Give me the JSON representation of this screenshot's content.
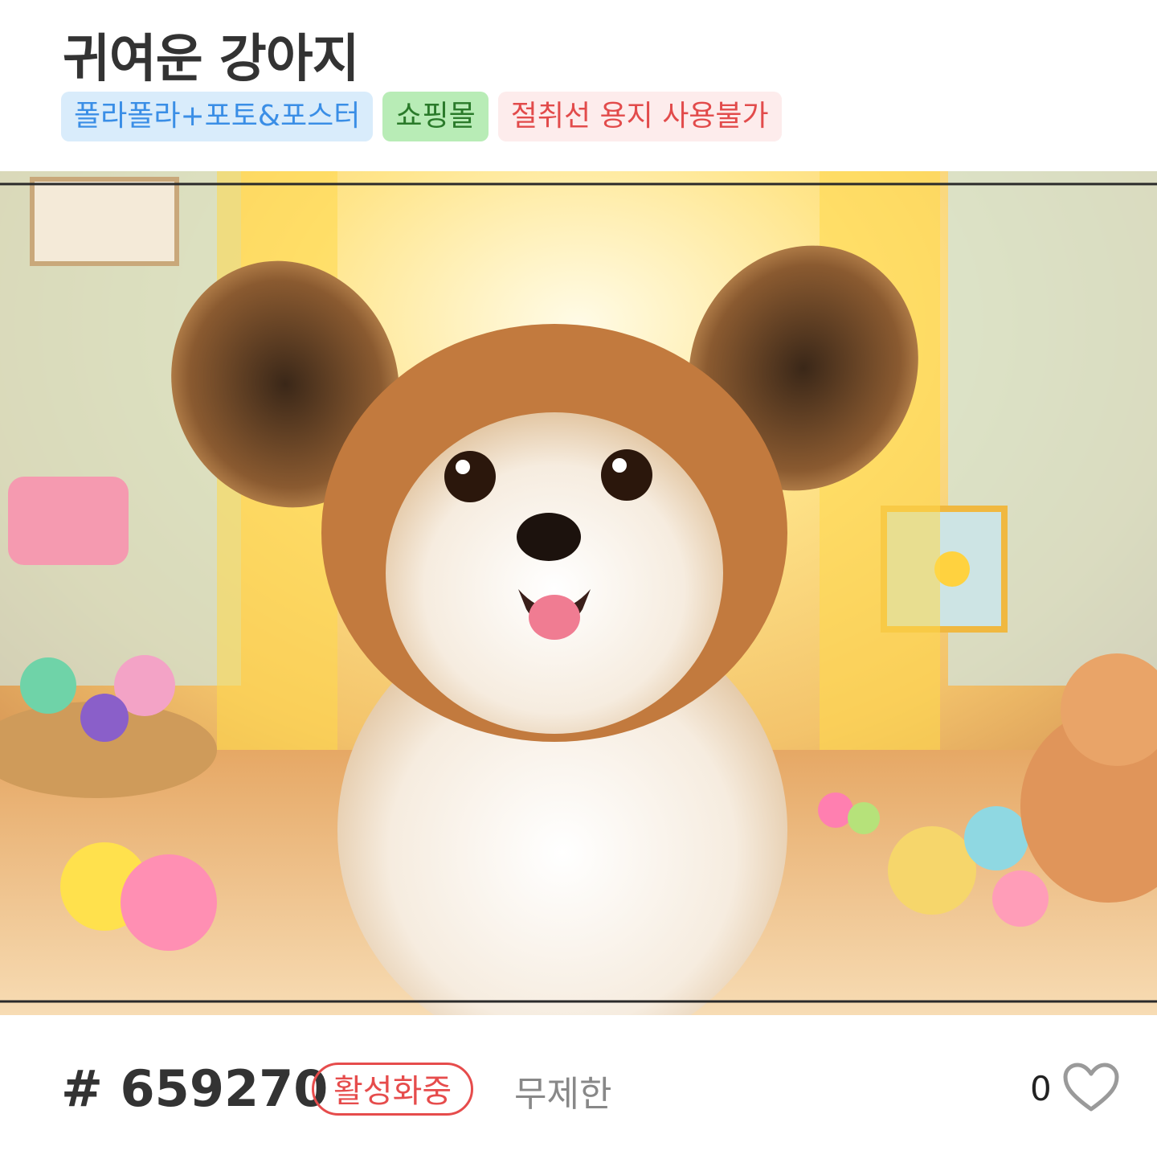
{
  "header": {
    "title": "귀여운 강아지"
  },
  "tags": [
    {
      "label": "폴라폴라+포토&포스터",
      "color": "#3a8ee6"
    },
    {
      "label": "쇼핑몰",
      "color": "#2a7a2a"
    },
    {
      "label": "절취선 용지 사용불가",
      "color": "#e24b4b"
    }
  ],
  "footer": {
    "id_label": "# 659270",
    "status": "활성화중",
    "duration": "무제한",
    "like_count": "0"
  }
}
